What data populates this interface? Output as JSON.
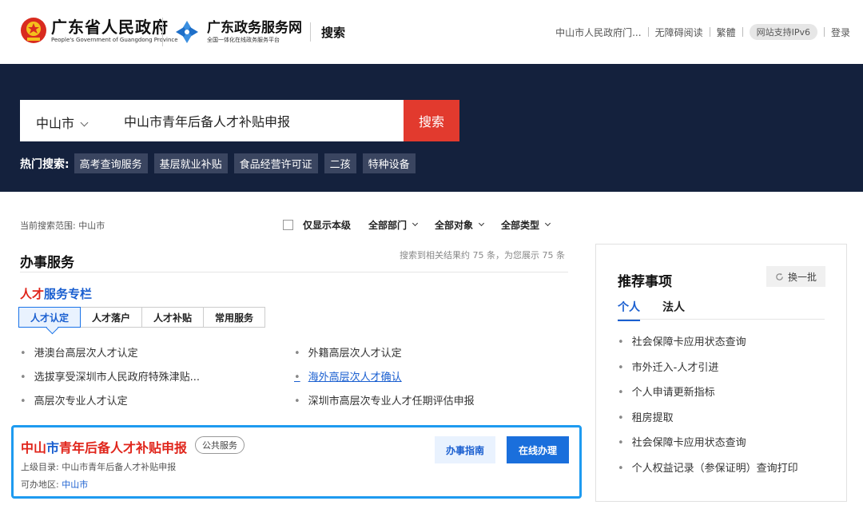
{
  "header": {
    "gov_name": "广东省人民政府",
    "gov_en": "People's Government of Guangdong Province",
    "svc_name": "广东政务服务网",
    "svc_sub": "全国一体化在线政务服务平台",
    "page_title": "搜索",
    "links": [
      "中山市人民政府门...",
      "无障碍阅读",
      "繁體"
    ],
    "ipv6": "网站支持IPv6",
    "login": "登录"
  },
  "search": {
    "city": "中山市",
    "query": "中山市青年后备人才补贴申报",
    "button": "搜索",
    "hot_label": "热门搜索:",
    "hot_tags": [
      "高考查询服务",
      "基层就业补贴",
      "食品经营许可证",
      "二孩",
      "特种设备"
    ]
  },
  "filters": {
    "scope": "当前搜索范围:  中山市",
    "local_only": "仅显示本级",
    "dept": "全部部门",
    "target": "全部对象",
    "type": "全部类型"
  },
  "section": {
    "title": "办事服务",
    "count": "搜索到相关结果约 75 条，为您展示 75 条"
  },
  "talent": {
    "title_red": "人才",
    "title_blue": "服务专栏",
    "tabs": [
      "人才认定",
      "人才落户",
      "人才补贴",
      "常用服务"
    ],
    "left_items": [
      "港澳台高层次人才认定",
      "选拔享受深圳市人民政府特殊津贴...",
      "高层次专业人才认定"
    ],
    "right_items": [
      "外籍高层次人才认定",
      "海外高层次人才确认",
      "深圳市高层次专业人才任期评估申报"
    ]
  },
  "result": {
    "title_red1": "中山",
    "title_blue": "市",
    "title_red2": "青年后备人才补贴申报",
    "badge": "公共服务",
    "parent": "上级目录: 中山市青年后备人才补贴申报",
    "region_label": "可办地区: ",
    "region": "中山市",
    "guide_button": "办事指南",
    "online_button": "在线办理"
  },
  "panel": {
    "title": "推荐事项",
    "refresh": "换一批",
    "tabs": [
      "个人",
      "法人"
    ],
    "items": [
      "社会保障卡应用状态查询",
      "市外迁入-人才引进",
      "个人申请更新指标",
      "租房提取",
      "社会保障卡应用状态查询",
      "个人权益记录（参保证明）查询打印"
    ]
  },
  "colors": {
    "banner": "#14213d",
    "search_button": "#e23a2e",
    "accent_blue": "#1a6fdc",
    "highlight_border": "#1e9bf0",
    "title_red": "#e0251b"
  }
}
